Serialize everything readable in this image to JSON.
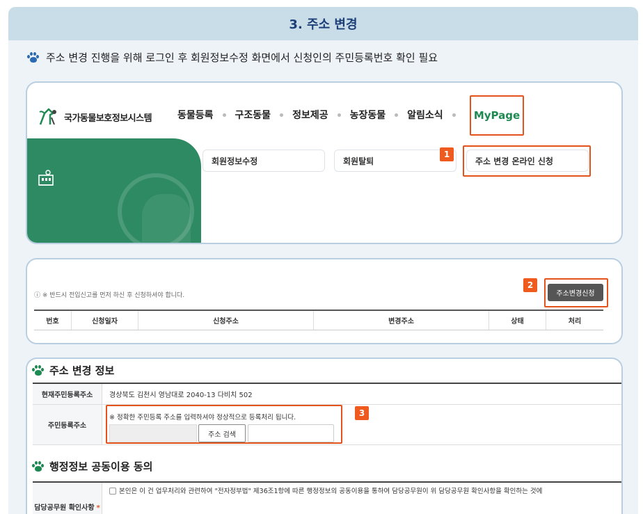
{
  "header": {
    "title": "3. 주소 변경"
  },
  "intro": {
    "text": "주소 변경 진행을 위해 로그인 후 회원정보수정 화면에서 신청인의 주민등록번호 확인 필요"
  },
  "site": {
    "logo_text": "국가동물보호정보시스템",
    "nav": [
      "동물등록",
      "구조동물",
      "정보제공",
      "농장동물",
      "알림소식"
    ],
    "mypage": "MyPage",
    "submenu": [
      "회원정보수정",
      "회원탈퇴",
      "주소 변경 온라인 신청"
    ]
  },
  "badges": [
    "1",
    "2",
    "3"
  ],
  "apply": {
    "notice": "ⓘ ※ 반드시 전입신고를 먼저 하신 후 신청하셔야 합니다.",
    "button": "주소변경신청",
    "columns": [
      "번호",
      "신청일자",
      "신청주소",
      "변경주소",
      "상태",
      "처리"
    ]
  },
  "address_info": {
    "title": "주소 변경 정보",
    "current_label": "현재주민등록주소",
    "current_value": "경상북도 김천시 영남대로 2040-13 다비치 502",
    "resident_label": "주민등록주소",
    "hint": "※ 정확한 주민등록 주소를 입력하셔야 정상적으로 등록처리 됩니다.",
    "search_button": "주소 검색"
  },
  "consent": {
    "title": "행정정보 공동이용 동의",
    "label": "담당공무원 확인사항",
    "required_mark": "*",
    "text": "본인은 이 건 업무처리와 관련하여 \"전자정부법\" 제36조1항에 따른 행정정보의 공동이용을 통하여 담당공무원이 위 담당공무원 확인사항을 확인하는 것에"
  },
  "colors": {
    "accent": "#e4531c",
    "brand_green": "#1e8a52",
    "header_bg": "#c9dde9",
    "title_blue": "#1c3f78"
  }
}
